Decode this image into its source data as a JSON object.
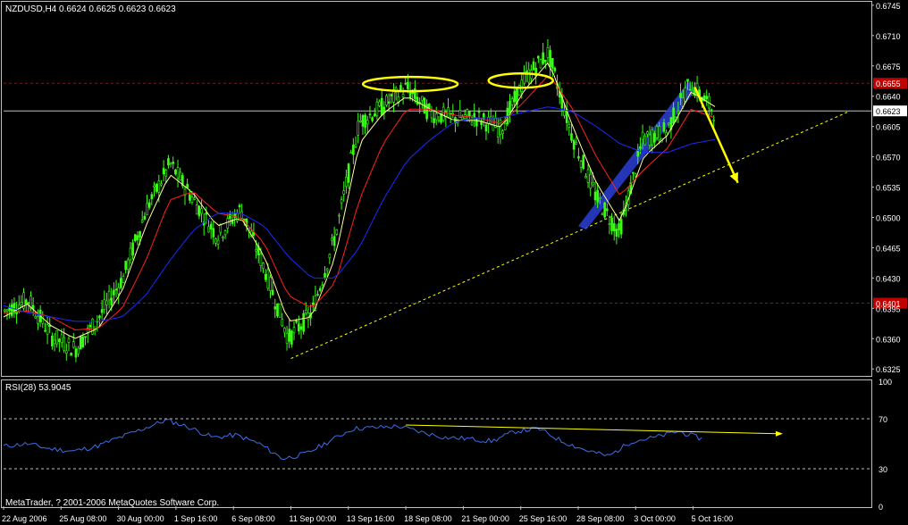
{
  "header": {
    "symbol_line": "NZDUSD,H4  0.6624 0.6625 0.6623 0.6623"
  },
  "rsi_panel": {
    "label": "RSI(28) 53.9045"
  },
  "footer": {
    "copyright": "MetaTrader, ? 2001-2006 MetaQuotes Software Corp."
  },
  "colors": {
    "background": "#000000",
    "candles": "#39ff14",
    "frame": "#c0c0c0",
    "ma_fast": "#ffff99",
    "ma_mid": "#ff2020",
    "ma_slow": "#1a2bff",
    "rsi_line": "#3a6eea",
    "annotation": "#ffff00",
    "level_line": "#c00000",
    "current_price_box": "#c0c0c0",
    "trend_highlight": "#2a3fd6"
  },
  "chart_data": [
    {
      "type": "candlestick",
      "title": "NZDUSD,H4",
      "ohlc_text": "0.6624 0.6625 0.6623 0.6623",
      "x_tick_labels": [
        "22 Aug 2006",
        "25 Aug 08:00",
        "30 Aug 00:00",
        "1 Sep 16:00",
        "6 Sep 08:00",
        "11 Sep 00:00",
        "13 Sep 16:00",
        "18 Sep 08:00",
        "21 Sep 00:00",
        "25 Sep 16:00",
        "28 Sep 08:00",
        "3 Oct 00:00",
        "5 Oct 16:00"
      ],
      "y_tick_labels": [
        "0.6745",
        "0.6710",
        "0.6675",
        "0.6640",
        "0.6605",
        "0.6570",
        "0.6535",
        "0.6500",
        "0.6465",
        "0.6430",
        "0.6395",
        "0.6360",
        "0.6325"
      ],
      "ylim": [
        0.6318,
        0.6748
      ],
      "close_path": {
        "x": [
          "22 Aug 2006",
          "23 Aug",
          "24 Aug",
          "25 Aug 08:00",
          "28 Aug",
          "30 Aug 00:00",
          "31 Aug",
          "1 Sep 16:00",
          "4 Sep",
          "6 Sep 08:00",
          "7 Sep",
          "8 Sep",
          "11 Sep 00:00",
          "12 Sep",
          "13 Sep 16:00",
          "14 Sep",
          "15 Sep",
          "18 Sep 08:00",
          "19 Sep",
          "20 Sep",
          "21 Sep 00:00",
          "22 Sep",
          "25 Sep 16:00",
          "26 Sep",
          "27 Sep",
          "28 Sep 08:00",
          "29 Sep",
          "2 Oct",
          "3 Oct 00:00",
          "4 Oct",
          "5 Oct 16:00"
        ],
        "y": [
          0.6392,
          0.6405,
          0.6362,
          0.6348,
          0.6385,
          0.643,
          0.651,
          0.6562,
          0.652,
          0.6478,
          0.651,
          0.644,
          0.636,
          0.639,
          0.648,
          0.661,
          0.6628,
          0.665,
          0.662,
          0.6615,
          0.6615,
          0.6602,
          0.666,
          0.669,
          0.6595,
          0.6525,
          0.6482,
          0.659,
          0.66,
          0.6655,
          0.6623
        ]
      },
      "moving_averages": [
        {
          "color": "#ffff99",
          "y": [
            0.6385,
            0.64,
            0.6375,
            0.636,
            0.6372,
            0.6415,
            0.649,
            0.655,
            0.6528,
            0.649,
            0.65,
            0.6455,
            0.638,
            0.6385,
            0.6455,
            0.6585,
            0.662,
            0.664,
            0.6625,
            0.6612,
            0.6612,
            0.6604,
            0.6648,
            0.668,
            0.6605,
            0.654,
            0.6495,
            0.657,
            0.6595,
            0.6645,
            0.6628
          ]
        },
        {
          "color": "#ff2020",
          "y": [
            0.639,
            0.6392,
            0.6385,
            0.637,
            0.6372,
            0.6395,
            0.645,
            0.652,
            0.653,
            0.6505,
            0.65,
            0.647,
            0.641,
            0.6395,
            0.6425,
            0.652,
            0.6585,
            0.6625,
            0.6625,
            0.6618,
            0.6615,
            0.6608,
            0.6635,
            0.6665,
            0.6625,
            0.657,
            0.6525,
            0.6555,
            0.658,
            0.6625,
            0.6615
          ]
        },
        {
          "color": "#1a2bff",
          "y": [
            0.6398,
            0.639,
            0.6385,
            0.638,
            0.638,
            0.6385,
            0.641,
            0.645,
            0.6485,
            0.6505,
            0.6505,
            0.649,
            0.6455,
            0.643,
            0.643,
            0.6465,
            0.652,
            0.6565,
            0.659,
            0.661,
            0.6615,
            0.6615,
            0.6622,
            0.6628,
            0.6622,
            0.6605,
            0.6585,
            0.6575,
            0.6575,
            0.6585,
            0.659
          ]
        }
      ],
      "horizontal_levels": [
        {
          "value": 0.6655,
          "label": "0.6655",
          "style": "dashed",
          "color": "#c00000"
        },
        {
          "value": 0.6623,
          "label": "0.6623",
          "style": "solid",
          "color": "#c0c0c0",
          "current_price": true
        },
        {
          "value": 0.6401,
          "label": "0.6401",
          "style": "dashed",
          "color": "#c00000"
        }
      ],
      "trendline": {
        "from": [
          "11 Sep 00:00",
          0.6337
        ],
        "to": [
          "5 Oct 16:00+",
          0.66
        ],
        "style": "dashed",
        "color": "#ffff00"
      },
      "annotations": [
        {
          "kind": "ellipse",
          "at": [
            "18 Sep 08:00",
            0.6654
          ],
          "color": "#ffff00"
        },
        {
          "kind": "ellipse",
          "at": [
            "25 Sep 16:00",
            0.6658
          ],
          "color": "#ffff00"
        },
        {
          "kind": "arrow",
          "from": [
            "5 Oct 16:00",
            0.665
          ],
          "to": [
            "5 Oct 16:00+",
            0.654
          ],
          "color": "#ffff00"
        },
        {
          "kind": "channel_highlight",
          "from": [
            "28 Sep 08:00",
            0.649
          ],
          "to": [
            "5 Oct 16:00",
            0.6655
          ],
          "color": "#2a3fd6"
        }
      ]
    },
    {
      "type": "line",
      "title": "RSI(28) 53.9045",
      "y_tick_labels": [
        "100",
        "70",
        "30",
        "0"
      ],
      "ylim": [
        0,
        100
      ],
      "levels": [
        70,
        30
      ],
      "rsi": [
        48,
        50,
        46,
        44,
        48,
        55,
        62,
        69,
        63,
        55,
        57,
        50,
        38,
        42,
        52,
        62,
        63,
        64,
        59,
        55,
        54,
        52,
        60,
        62,
        52,
        45,
        40,
        52,
        55,
        60,
        54
      ],
      "divergence_line": {
        "from": [
          "18 Sep 08:00",
          65
        ],
        "to": [
          "5 Oct 16:00+",
          58
        ],
        "color": "#ffff00"
      }
    }
  ]
}
